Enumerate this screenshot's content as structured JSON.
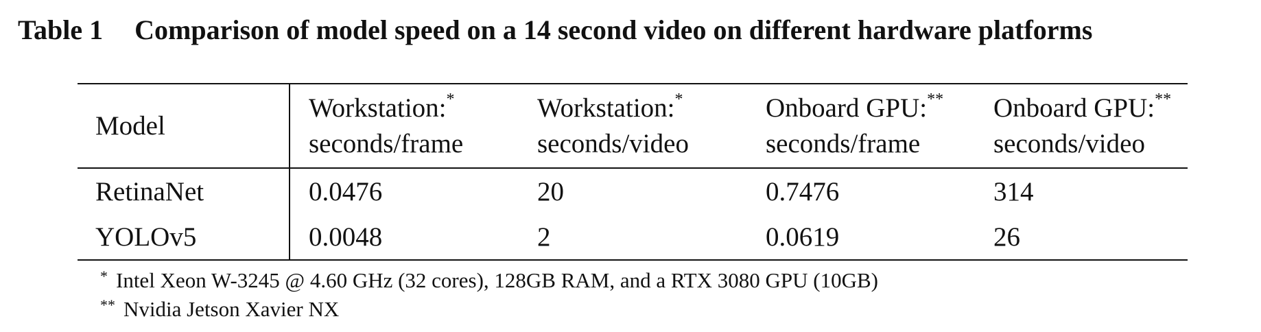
{
  "caption": {
    "number": "Table 1",
    "text": "Comparison of model speed on a 14 second video on different hardware platforms"
  },
  "table": {
    "header": {
      "model": "Model",
      "columns": [
        {
          "line1": "Workstation:",
          "mark": "*",
          "line2": "seconds/frame"
        },
        {
          "line1": "Workstation:",
          "mark": "*",
          "line2": "seconds/video"
        },
        {
          "line1": "Onboard GPU:",
          "mark": "**",
          "line2": "seconds/frame"
        },
        {
          "line1": "Onboard GPU:",
          "mark": "**",
          "line2": "seconds/video"
        }
      ]
    },
    "rows": [
      {
        "model": "RetinaNet",
        "values": [
          "0.0476",
          "20",
          "0.7476",
          "314"
        ]
      },
      {
        "model": "YOLOv5",
        "values": [
          "0.0048",
          "2",
          "0.0619",
          "26"
        ]
      }
    ]
  },
  "footnotes": [
    {
      "mark": "*",
      "text": "Intel Xeon W-3245 @ 4.60 GHz (32 cores), 128GB RAM, and a RTX 3080 GPU (10GB)"
    },
    {
      "mark": "**",
      "text": "Nvidia Jetson Xavier NX"
    }
  ]
}
